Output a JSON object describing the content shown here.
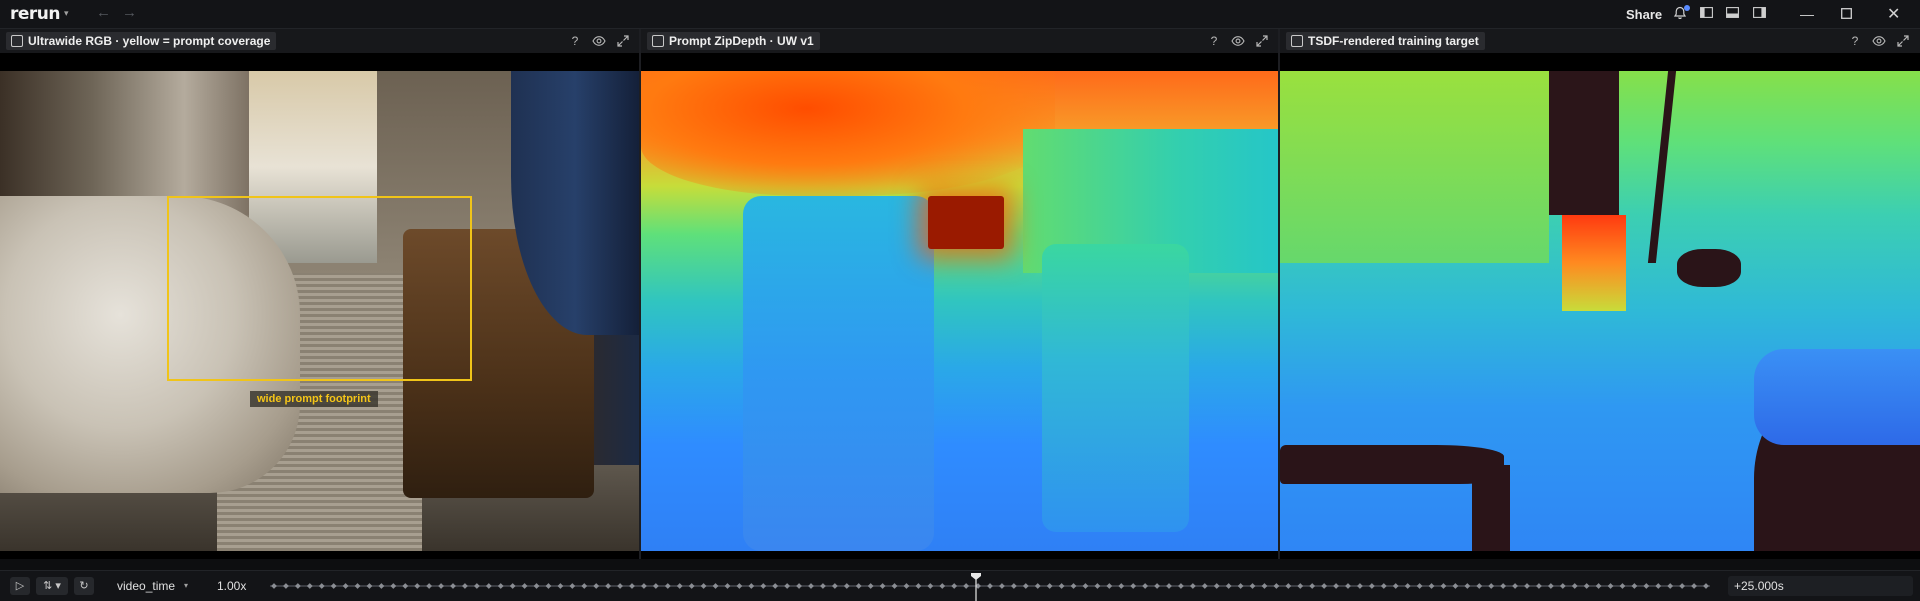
{
  "app": {
    "logo": "rerun",
    "share_label": "Share"
  },
  "panels": [
    {
      "title": "Ultrawide RGB · yellow = prompt coverage"
    },
    {
      "title": "Prompt ZipDepth · UW v1"
    },
    {
      "title": "TSDF-rendered training target"
    }
  ],
  "overlay": {
    "prompt_label": "wide prompt footprint",
    "box_color": "#f0c419"
  },
  "timeline": {
    "name": "video_time",
    "speed": "1.00x",
    "time": "+25.000s",
    "playhead_fraction": 0.49
  },
  "icons": {
    "help": "?",
    "visibility": "eye-icon",
    "expand": "maximize-icon"
  }
}
